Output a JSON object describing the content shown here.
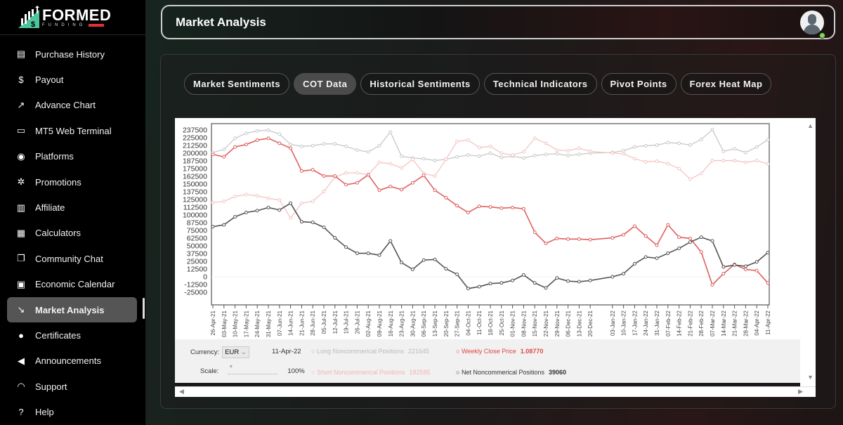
{
  "brand": {
    "name": "FORMED",
    "sub": "FUNDING"
  },
  "sidebar": {
    "items": [
      {
        "label": "Purchase History",
        "icon": "receipt-icon",
        "glyph": "▤"
      },
      {
        "label": "Payout",
        "icon": "dollar-icon",
        "glyph": "$"
      },
      {
        "label": "Advance Chart",
        "icon": "trend-up-icon",
        "glyph": "↗"
      },
      {
        "label": "MT5 Web Terminal",
        "icon": "browser-window-icon",
        "glyph": "▭"
      },
      {
        "label": "Platforms",
        "icon": "platforms-sync-icon",
        "glyph": "◉"
      },
      {
        "label": "Promotions",
        "icon": "discount-badge-icon",
        "glyph": "✲"
      },
      {
        "label": "Affiliate",
        "icon": "bar-chart-icon",
        "glyph": "▥"
      },
      {
        "label": "Calculators",
        "icon": "calculator-icon",
        "glyph": "▦"
      },
      {
        "label": "Community Chat",
        "icon": "chat-bubbles-icon",
        "glyph": "❐"
      },
      {
        "label": "Economic Calendar",
        "icon": "calendar-icon",
        "glyph": "▣"
      },
      {
        "label": "Market Analysis",
        "icon": "trend-down-icon",
        "glyph": "↘",
        "active": true
      },
      {
        "label": "Certificates",
        "icon": "award-icon",
        "glyph": "●"
      },
      {
        "label": "Announcements",
        "icon": "megaphone-icon",
        "glyph": "◀"
      },
      {
        "label": "Support",
        "icon": "headset-icon",
        "glyph": "◠"
      },
      {
        "label": "Help",
        "icon": "question-icon",
        "glyph": "?"
      }
    ]
  },
  "header": {
    "title": "Market Analysis"
  },
  "tabs": [
    {
      "label": "Market Sentiments"
    },
    {
      "label": "COT Data",
      "active": true
    },
    {
      "label": "Historical Sentiments"
    },
    {
      "label": "Technical Indicators"
    },
    {
      "label": "Pivot Points"
    },
    {
      "label": "Forex Heat Map"
    }
  ],
  "controls": {
    "currency_label": "Currency:",
    "currency_value": "EUR",
    "scale_label": "Scale:",
    "scale_value": "100%",
    "date": "11-Apr-22"
  },
  "legend": {
    "long": {
      "label": "Long Noncommerical Positions",
      "value": "221645"
    },
    "short": {
      "label": "Short Noncommerical Positions",
      "value": "182585"
    },
    "price": {
      "label": "Weekly Close Price",
      "value": "1.08770"
    },
    "net": {
      "label": "Net Noncommerical Positions",
      "value": "39060"
    }
  },
  "chart_data": {
    "type": "line",
    "title": "",
    "xlabel": "",
    "ylabel": "",
    "ylim": [
      -25000,
      237500
    ],
    "yticks": [
      "237500",
      "225000",
      "212500",
      "200000",
      "187500",
      "175000",
      "162500",
      "150000",
      "137500",
      "125000",
      "112500",
      "100000",
      "87500",
      "75000",
      "62500",
      "50000",
      "37500",
      "25000",
      "12500",
      "0",
      "-12500",
      "-25000"
    ],
    "x": [
      "26-Apr-21",
      "03-May-21",
      "10-May-21",
      "17-May-21",
      "24-May-21",
      "31-May-21",
      "07-Jun-21",
      "14-Jun-21",
      "21-Jun-21",
      "28-Jun-21",
      "05-Jul-21",
      "12-Jul-21",
      "19-Jul-21",
      "26-Jul-21",
      "02-Aug-21",
      "09-Aug-21",
      "16-Aug-21",
      "23-Aug-21",
      "30-Aug-21",
      "06-Sep-21",
      "13-Sep-21",
      "20-Sep-21",
      "27-Sep-21",
      "04-Oct-21",
      "11-Oct-21",
      "18-Oct-21",
      "25-Oct-21",
      "01-Nov-21",
      "08-Nov-21",
      "15-Nov-21",
      "22-Nov-21",
      "29-Nov-21",
      "06-Dec-21",
      "13-Dec-21",
      "20-Dec-21",
      "03-Jan-22",
      "10-Jan-22",
      "17-Jan-22",
      "24-Jan-22",
      "31-Jan-22",
      "07-Feb-22",
      "14-Feb-22",
      "21-Feb-22",
      "28-Feb-22",
      "07-Mar-22",
      "14-Mar-22",
      "21-Mar-22",
      "28-Mar-22",
      "04-Apr-22",
      "11-Apr-22"
    ],
    "series": [
      {
        "name": "Long Noncommerical Positions",
        "color": "#c8c8c8",
        "values": [
          201000,
          206000,
          224000,
          232000,
          236000,
          237000,
          231000,
          214000,
          211000,
          212000,
          215000,
          215000,
          211000,
          205000,
          202000,
          212000,
          234000,
          195000,
          192000,
          191000,
          188000,
          190000,
          194000,
          197000,
          195000,
          200000,
          193000,
          195000,
          192000,
          196000,
          198000,
          199000,
          196000,
          198000,
          200000,
          201000,
          204000,
          210000,
          212000,
          213000,
          217000,
          216000,
          213000,
          222000,
          238000,
          203000,
          207000,
          201000,
          210000,
          221645
        ]
      },
      {
        "name": "Short Noncommerical Positions",
        "color": "#f4c4c4",
        "values": [
          120000,
          122000,
          130000,
          133000,
          131000,
          127000,
          124000,
          95000,
          119000,
          122000,
          138000,
          161000,
          168000,
          168000,
          165000,
          185000,
          183000,
          176000,
          190000,
          167000,
          163000,
          190000,
          219000,
          221000,
          209000,
          211000,
          200000,
          197000,
          202000,
          224000,
          216000,
          205000,
          204000,
          208000,
          203000,
          200000,
          199000,
          191000,
          186000,
          187000,
          183000,
          175000,
          158000,
          167000,
          188000,
          188000,
          188000,
          185000,
          188000,
          182585
        ]
      },
      {
        "name": "Weekly Close Price",
        "color": "#e06060",
        "axis": "secondary",
        "values": [
          198000,
          194000,
          210000,
          214000,
          221000,
          224000,
          216000,
          208000,
          171000,
          173000,
          163000,
          163000,
          149000,
          152000,
          165000,
          140000,
          146000,
          141000,
          152000,
          164000,
          140000,
          128000,
          115000,
          104000,
          114000,
          113000,
          111000,
          112000,
          110000,
          72000,
          54000,
          62000,
          61000,
          61000,
          60000,
          63000,
          68000,
          82000,
          66000,
          51000,
          84000,
          64000,
          62000,
          40000,
          -13000,
          5000,
          20000,
          12000,
          10000,
          -10000
        ],
        "last_value": 1.0877
      },
      {
        "name": "Net Noncommerical Positions",
        "color": "#555555",
        "values": [
          81000,
          84000,
          97000,
          104000,
          107000,
          112000,
          108000,
          119000,
          89000,
          88000,
          80000,
          63000,
          48000,
          38000,
          38000,
          35000,
          58000,
          23000,
          12000,
          27000,
          28000,
          13000,
          4000,
          -19000,
          -16000,
          -11000,
          -10000,
          -6000,
          3000,
          -10000,
          -18000,
          -2000,
          -7000,
          -8000,
          -6000,
          0,
          5000,
          21000,
          32000,
          30000,
          38000,
          46000,
          56000,
          64000,
          58000,
          16000,
          19000,
          17000,
          24000,
          39060
        ]
      }
    ],
    "legend_position": "bottom",
    "grid": false
  }
}
